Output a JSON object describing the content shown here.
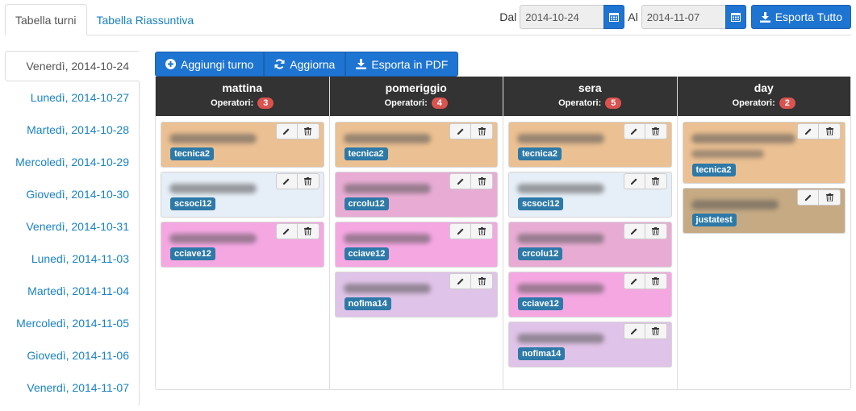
{
  "tabs": [
    {
      "label": "Tabella turni",
      "active": true
    },
    {
      "label": "Tabella Riassuntiva",
      "active": false
    }
  ],
  "date_range": {
    "from_label": "Dal",
    "from_value": "2014-10-24",
    "to_label": "Al",
    "to_value": "2014-11-07",
    "export_all_label": "Esporta Tutto"
  },
  "days": [
    "Venerdì, 2014-10-24",
    "Lunedì, 2014-10-27",
    "Martedì, 2014-10-28",
    "Mercoledì, 2014-10-29",
    "Giovedì, 2014-10-30",
    "Venerdì, 2014-10-31",
    "Lunedì, 2014-11-03",
    "Martedì, 2014-11-04",
    "Mercoledì, 2014-11-05",
    "Giovedì, 2014-11-06",
    "Venerdì, 2014-11-07"
  ],
  "toolbar": {
    "add_label": "Aggiungi turno",
    "refresh_label": "Aggiorna",
    "pdf_label": "Esporta in PDF"
  },
  "operators_label": "Operatori:",
  "columns": [
    {
      "title": "mattina",
      "count": "3",
      "cards": [
        {
          "tag": "tecnica2",
          "color": "#ebc092"
        },
        {
          "tag": "scsoci12",
          "color": "#e6eef7"
        },
        {
          "tag": "cciave12",
          "color": "#f5a7e2"
        }
      ]
    },
    {
      "title": "pomeriggio",
      "count": "4",
      "cards": [
        {
          "tag": "tecnica2",
          "color": "#ebc092"
        },
        {
          "tag": "crcolu12",
          "color": "#e8acd4"
        },
        {
          "tag": "cciave12",
          "color": "#f5a7e2"
        },
        {
          "tag": "nofima14",
          "color": "#e0c3e8"
        }
      ]
    },
    {
      "title": "sera",
      "count": "5",
      "cards": [
        {
          "tag": "tecnica2",
          "color": "#ebc092"
        },
        {
          "tag": "scsoci12",
          "color": "#e6eef7"
        },
        {
          "tag": "crcolu12",
          "color": "#e8acd4"
        },
        {
          "tag": "cciave12",
          "color": "#f5a7e2"
        },
        {
          "tag": "nofima14",
          "color": "#e0c3e8"
        }
      ]
    },
    {
      "title": "day",
      "count": "2",
      "cards": [
        {
          "tag": "tecnica2",
          "color": "#ebc092",
          "tall": true
        },
        {
          "tag": "justatest",
          "color": "#c5aa83"
        }
      ]
    }
  ]
}
